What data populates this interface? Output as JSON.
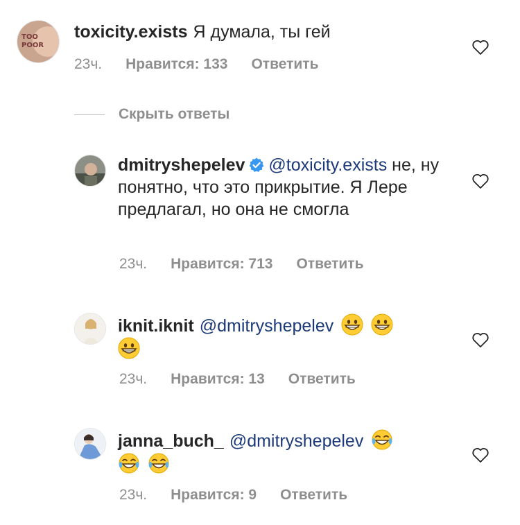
{
  "comments": [
    {
      "username": "toxicity.exists",
      "mention": "",
      "text": "Я думала, ты гей",
      "time": "23ч.",
      "likes": "Нравится: 133",
      "reply": "Ответить"
    },
    {
      "username": "dmitryshepelev",
      "mention": "@toxicity.exists",
      "text": "не, ну понятно, что это прикрытие. Я Лере предлагал, но она не смогла",
      "time": "23ч.",
      "likes": "Нравится: 713",
      "reply": "Ответить"
    },
    {
      "username": "iknit.iknit",
      "mention": "@dmitryshepelev",
      "text": "",
      "time": "23ч.",
      "likes": "Нравится: 13",
      "reply": "Ответить"
    },
    {
      "username": "janna_buch_",
      "mention": "@dmitryshepelev",
      "text": "",
      "time": "23ч.",
      "likes": "Нравится: 9",
      "reply": "Ответить"
    }
  ],
  "hide_replies_label": "Скрыть ответы",
  "icons": {
    "like": "heart-outline-icon",
    "verified": "verified-badge-icon",
    "emoji_grin": "grinning-face-emoji",
    "emoji_tears": "tears-of-joy-emoji"
  },
  "colors": {
    "mention": "#1c3a7a",
    "meta": "#8e8e8e",
    "verified": "#3897f0"
  }
}
